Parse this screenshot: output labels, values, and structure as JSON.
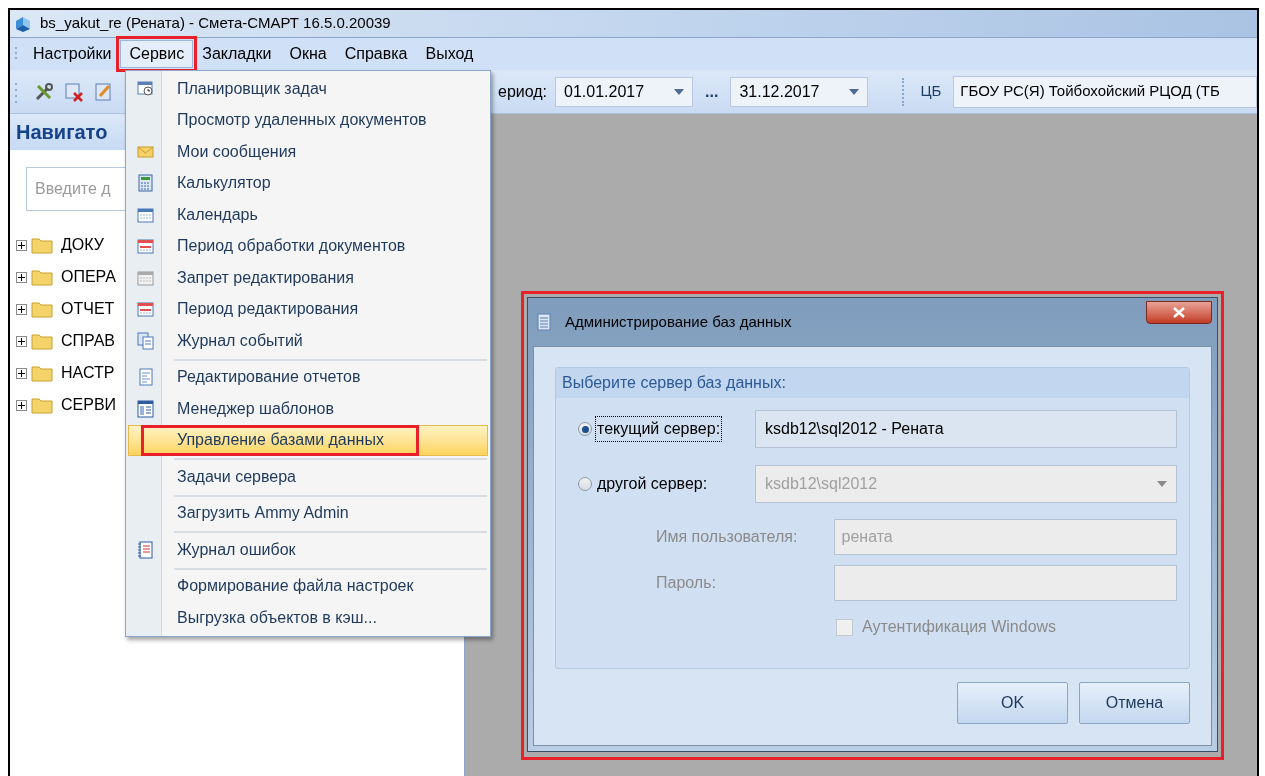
{
  "window": {
    "title": "bs_yakut_re (Рената) - Смета-СМАРТ 16.5.0.20039"
  },
  "menu_bar": [
    {
      "label": "Настройки",
      "selected": false,
      "annotated": false
    },
    {
      "label": "Сервис",
      "selected": true,
      "annotated": true
    },
    {
      "label": "Закладки",
      "selected": false,
      "annotated": false
    },
    {
      "label": "Окна",
      "selected": false,
      "annotated": false
    },
    {
      "label": "Справка",
      "selected": false,
      "annotated": false
    },
    {
      "label": "Выход",
      "selected": false,
      "annotated": false
    }
  ],
  "toolbar": {
    "period_label": "ериод:",
    "period_from": "01.01.2017",
    "range_separator": "...",
    "period_to": "31.12.2017",
    "org_label": "ЦБ",
    "org_value": "ГБОУ РС(Я) Тойбохойский РЦОД (ТБ"
  },
  "navigator": {
    "title": "Навигато",
    "search_placeholder": "Введите д",
    "tree": [
      {
        "label": "ДОКУ",
        "expanded": false
      },
      {
        "label": "ОПЕРА",
        "expanded": false
      },
      {
        "label": "ОТЧЕТ",
        "expanded": false
      },
      {
        "label": "СПРАВ",
        "expanded": false
      },
      {
        "label": "НАСТР",
        "expanded": false
      },
      {
        "label": "СЕРВИ",
        "expanded": false
      }
    ]
  },
  "service_menu": [
    {
      "label": "Планировщик задач",
      "separator_before": false,
      "highlighted": false,
      "annotated": false
    },
    {
      "label": "Просмотр удаленных документов",
      "separator_before": false,
      "highlighted": false,
      "annotated": false
    },
    {
      "label": "Мои сообщения",
      "separator_before": false,
      "highlighted": false,
      "annotated": false
    },
    {
      "label": "Калькулятор",
      "separator_before": false,
      "highlighted": false,
      "annotated": false
    },
    {
      "label": "Календарь",
      "separator_before": false,
      "highlighted": false,
      "annotated": false
    },
    {
      "label": "Период обработки документов",
      "separator_before": false,
      "highlighted": false,
      "annotated": false
    },
    {
      "label": "Запрет редактирования",
      "separator_before": false,
      "highlighted": false,
      "annotated": false
    },
    {
      "label": "Период редактирования",
      "separator_before": false,
      "highlighted": false,
      "annotated": false
    },
    {
      "label": "Журнал событий",
      "separator_before": false,
      "highlighted": false,
      "annotated": false
    },
    {
      "label": "Редактирование отчетов",
      "separator_before": true,
      "highlighted": false,
      "annotated": false
    },
    {
      "label": "Менеджер шаблонов",
      "separator_before": false,
      "highlighted": false,
      "annotated": false
    },
    {
      "label": "Управление базами данных",
      "separator_before": false,
      "highlighted": true,
      "annotated": true
    },
    {
      "label": "Задачи сервера",
      "separator_before": true,
      "highlighted": false,
      "annotated": false
    },
    {
      "label": "Загрузить Ammy Admin",
      "separator_before": true,
      "highlighted": false,
      "annotated": false
    },
    {
      "label": "Журнал ошибок",
      "separator_before": true,
      "highlighted": false,
      "annotated": false
    },
    {
      "label": "Формирование файла настроек",
      "separator_before": true,
      "highlighted": false,
      "annotated": false
    },
    {
      "label": "Выгрузка объектов в кэш...",
      "separator_before": false,
      "highlighted": false,
      "annotated": false
    }
  ],
  "dialog": {
    "title": "Администрирование баз данных",
    "annotated": true,
    "group_title": "Выберите сервер баз данных:",
    "options": [
      {
        "label": "текущий сервер:",
        "selected": true,
        "kind": "text",
        "value": "ksdb12\\sql2012 - Рената",
        "disabled": false
      },
      {
        "label": "другой сервер:",
        "selected": false,
        "kind": "dropdown",
        "value": "ksdb12\\sql2012",
        "disabled": true
      }
    ],
    "credentials": {
      "disabled": true,
      "username_label": "Имя пользователя:",
      "username_value": "рената",
      "password_label": "Пароль:"
    },
    "windows_auth": {
      "label": "Аутентификация Windows",
      "checked": false,
      "disabled": true
    },
    "buttons": [
      "OK",
      "Отмена"
    ]
  }
}
